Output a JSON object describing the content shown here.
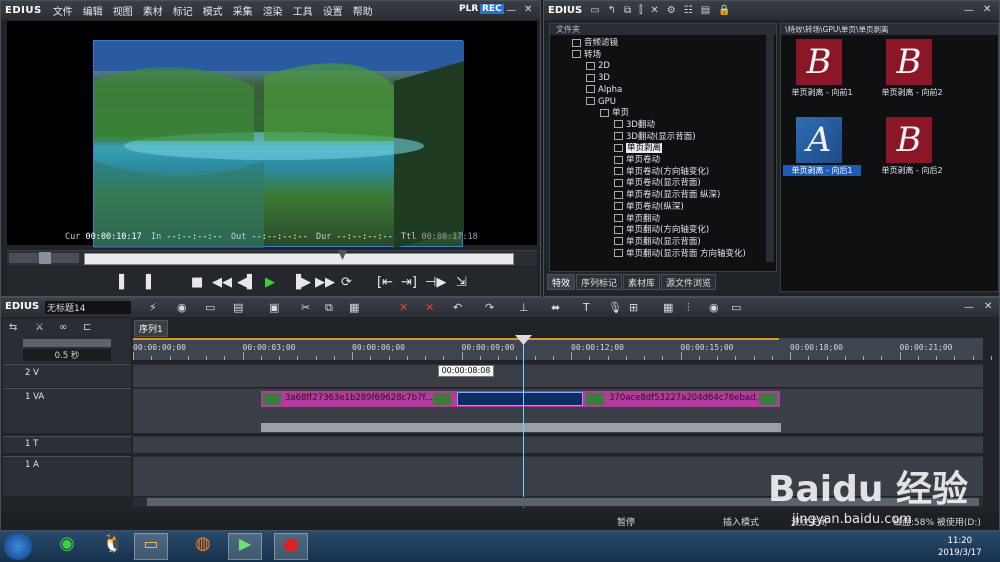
{
  "player": {
    "logo": "EDIUS",
    "menu": [
      "文件",
      "编辑",
      "视图",
      "素材",
      "标记",
      "模式",
      "采集",
      "渲染",
      "工具",
      "设置",
      "帮助"
    ],
    "plr": "PLR",
    "rec": "REC",
    "timecodes": {
      "cur_label": "Cur",
      "cur": "00:00:10:17",
      "in_label": "In",
      "in": "--:--:--:--",
      "out_label": "Out",
      "out": "--:--:--:--",
      "dur_label": "Dur",
      "dur": "--:--:--:--",
      "ttl_label": "Ttl",
      "ttl": "00:00:17:18"
    }
  },
  "bin": {
    "logo": "EDIUS",
    "tree_header": "文件夹",
    "tree": [
      {
        "label": "音频滤镜",
        "indent": 1
      },
      {
        "label": "转场",
        "indent": 1
      },
      {
        "label": "2D",
        "indent": 2
      },
      {
        "label": "3D",
        "indent": 2
      },
      {
        "label": "Alpha",
        "indent": 2
      },
      {
        "label": "GPU",
        "indent": 2
      },
      {
        "label": "单页",
        "indent": 3
      },
      {
        "label": "3D翻动",
        "indent": 4
      },
      {
        "label": "3D翻动(显示背面)",
        "indent": 4
      },
      {
        "label": "单页剥离",
        "indent": 4,
        "selected": true
      },
      {
        "label": "单页卷动",
        "indent": 4
      },
      {
        "label": "单页卷动(方向轴变化)",
        "indent": 4
      },
      {
        "label": "单页卷动(显示背面)",
        "indent": 4
      },
      {
        "label": "单页卷动(显示背面 纵深)",
        "indent": 4
      },
      {
        "label": "单页卷动(纵深)",
        "indent": 4
      },
      {
        "label": "单页翻动",
        "indent": 4
      },
      {
        "label": "单页翻动(方向轴变化)",
        "indent": 4
      },
      {
        "label": "单页翻动(显示背面)",
        "indent": 4
      },
      {
        "label": "单页翻动(显示背面 方向轴变化)",
        "indent": 4
      }
    ],
    "tabs": [
      "特效",
      "序列标记",
      "素材库",
      "源文件浏览"
    ],
    "clip_path": "\\特效\\转场\\GPU\\单页\\单页剥离",
    "clips": [
      {
        "label": "单页剥离 - 向前1",
        "letter": "B",
        "variant": "red",
        "selected": false
      },
      {
        "label": "单页剥离 - 向前2",
        "letter": "B",
        "variant": "red",
        "selected": false
      },
      {
        "label": "单页剥离 - 向后1",
        "letter": "A",
        "variant": "blue",
        "selected": true
      },
      {
        "label": "单页剥离 - 向后2",
        "letter": "B",
        "variant": "red",
        "selected": false
      }
    ]
  },
  "timeline": {
    "logo": "EDIUS",
    "project": "无标题14",
    "sequence_tab": "序列1",
    "zoom_label": "0.5 秒",
    "ruler": [
      "00:00:00;00",
      "00:00:03;00",
      "00:00:06;00",
      "00:00:09;00",
      "00:00:12;00",
      "00:00:15;00",
      "00:00:18;00",
      "00:00:21;00"
    ],
    "tooltip": "00:00:08:08",
    "tracks": [
      {
        "name": "2 V"
      },
      {
        "name": "1 VA"
      },
      {
        "name": "1 T"
      },
      {
        "name": "1 A"
      }
    ],
    "clip_a": "3a68ff27363e1b289f69628c7b7f...",
    "clip_b": "370ace8df53227a204d64c76ebad...",
    "status": {
      "stop": "暂停",
      "insert": "插入模式",
      "wave": "波纹关闭",
      "disk": "磁盘:58% 被使用(D:)"
    }
  },
  "taskbar": {
    "time": "11:20",
    "date": "2019/3/17"
  },
  "watermark": {
    "brand": "Baidu 经验",
    "url": "jingyan.baidu.com"
  }
}
